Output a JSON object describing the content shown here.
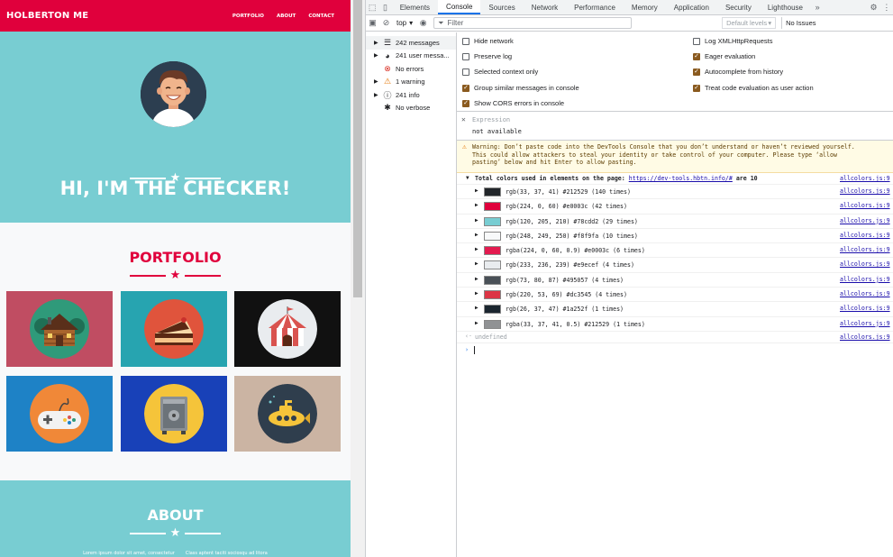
{
  "site": {
    "brand": "HOLBERTON ME",
    "nav": [
      "PORTFOLIO",
      "ABOUT",
      "CONTACT"
    ],
    "hero_title": "HI, I'M THE CHECKER!",
    "portfolio_title": "PORTFOLIO",
    "about_title": "ABOUT",
    "about_text": [
      "Lorem ipsum dolor sit amet, consectetur",
      "Class aptent taciti sociosqu ad litora"
    ],
    "tiles": [
      {
        "icon": "cabin-icon",
        "bg": "#c04d62",
        "circle": "#2f9a7a"
      },
      {
        "icon": "cake-icon",
        "bg": "#27a4b0",
        "circle": "#e0543c"
      },
      {
        "icon": "circus-tent-icon",
        "bg": "#111111",
        "circle": "#e9ecef"
      },
      {
        "icon": "gamepad-icon",
        "bg": "#1e82c6",
        "circle": "#f08838"
      },
      {
        "icon": "safe-icon",
        "bg": "#1841b8",
        "circle": "#f5c43a"
      },
      {
        "icon": "submarine-icon",
        "bg": "#cbb4a3",
        "circle": "#2f3e4d"
      }
    ]
  },
  "devtools": {
    "tabs": [
      "Elements",
      "Console",
      "Sources",
      "Network",
      "Performance",
      "Memory",
      "Application",
      "Security",
      "Lighthouse"
    ],
    "active_tab": "Console",
    "toolbar": {
      "context": "top",
      "filter_placeholder": "Filter",
      "levels": "Default levels",
      "issues": "No Issues"
    },
    "sidebar": [
      {
        "label": "242 messages",
        "icon": "list-icon",
        "expand": true
      },
      {
        "label": "241 user messa...",
        "icon": "user-icon",
        "expand": true
      },
      {
        "label": "No errors",
        "icon": "error-icon",
        "expand": false
      },
      {
        "label": "1 warning",
        "icon": "warning-icon",
        "expand": true
      },
      {
        "label": "241 info",
        "icon": "info-icon",
        "expand": true
      },
      {
        "label": "No verbose",
        "icon": "bug-icon",
        "expand": false
      }
    ],
    "settings_left": [
      {
        "label": "Hide network",
        "checked": false
      },
      {
        "label": "Preserve log",
        "checked": false
      },
      {
        "label": "Selected context only",
        "checked": false
      },
      {
        "label": "Group similar messages in console",
        "checked": true
      },
      {
        "label": "Show CORS errors in console",
        "checked": true
      }
    ],
    "settings_right": [
      {
        "label": "Log XMLHttpRequests",
        "checked": false
      },
      {
        "label": "Eager evaluation",
        "checked": true
      },
      {
        "label": "Autocomplete from history",
        "checked": true
      },
      {
        "label": "Treat code evaluation as user action",
        "checked": true
      }
    ],
    "expression": {
      "placeholder": "Expression",
      "value": "not available"
    },
    "warning": [
      "Warning: Don’t paste code into the DevTools Console that you don’t understand or haven’t reviewed yourself.",
      "This could allow attackers to steal your identity or take control of your computer. Please type ‘allow",
      "pasting’ below and hit Enter to allow pasting."
    ],
    "log_header": {
      "prefix": "Total colors used in elements on the page:",
      "link": "https://dev-tools.hbtn.info/#",
      "suffix": "are 10",
      "source": "allcolors.js:9"
    },
    "colors": [
      {
        "text": "rgb(33, 37, 41) #212529 (140 times)",
        "hex": "#212529",
        "source": "allcolors.js:9"
      },
      {
        "text": "rgb(224, 0, 60) #e0003c (42 times)",
        "hex": "#e0003c",
        "source": "allcolors.js:9"
      },
      {
        "text": "rgb(120, 205, 210) #78cdd2 (29 times)",
        "hex": "#78cdd2",
        "source": "allcolors.js:9"
      },
      {
        "text": "rgb(248, 249, 250) #f8f9fa (10 times)",
        "hex": "#f8f9fa",
        "source": "allcolors.js:9"
      },
      {
        "text": "rgba(224, 0, 60, 0.9) #e0003c (6 times)",
        "hex": "#e31a4f",
        "source": "allcolors.js:9"
      },
      {
        "text": "rgb(233, 236, 239) #e9ecef (4 times)",
        "hex": "#e9ecef",
        "source": "allcolors.js:9"
      },
      {
        "text": "rgb(73, 80, 87) #495057 (4 times)",
        "hex": "#495057",
        "source": "allcolors.js:9"
      },
      {
        "text": "rgb(220, 53, 69) #dc3545 (4 times)",
        "hex": "#dc3545",
        "source": "allcolors.js:9"
      },
      {
        "text": "rgb(26, 37, 47) #1a252f (1 times)",
        "hex": "#1a252f",
        "source": "allcolors.js:9"
      },
      {
        "text": "rgba(33, 37, 41, 0.5) #212529 (1 times)",
        "hex": "#909294",
        "source": "allcolors.js:9"
      }
    ],
    "result": {
      "value": "undefined",
      "source": "allcolors.js:9"
    }
  }
}
